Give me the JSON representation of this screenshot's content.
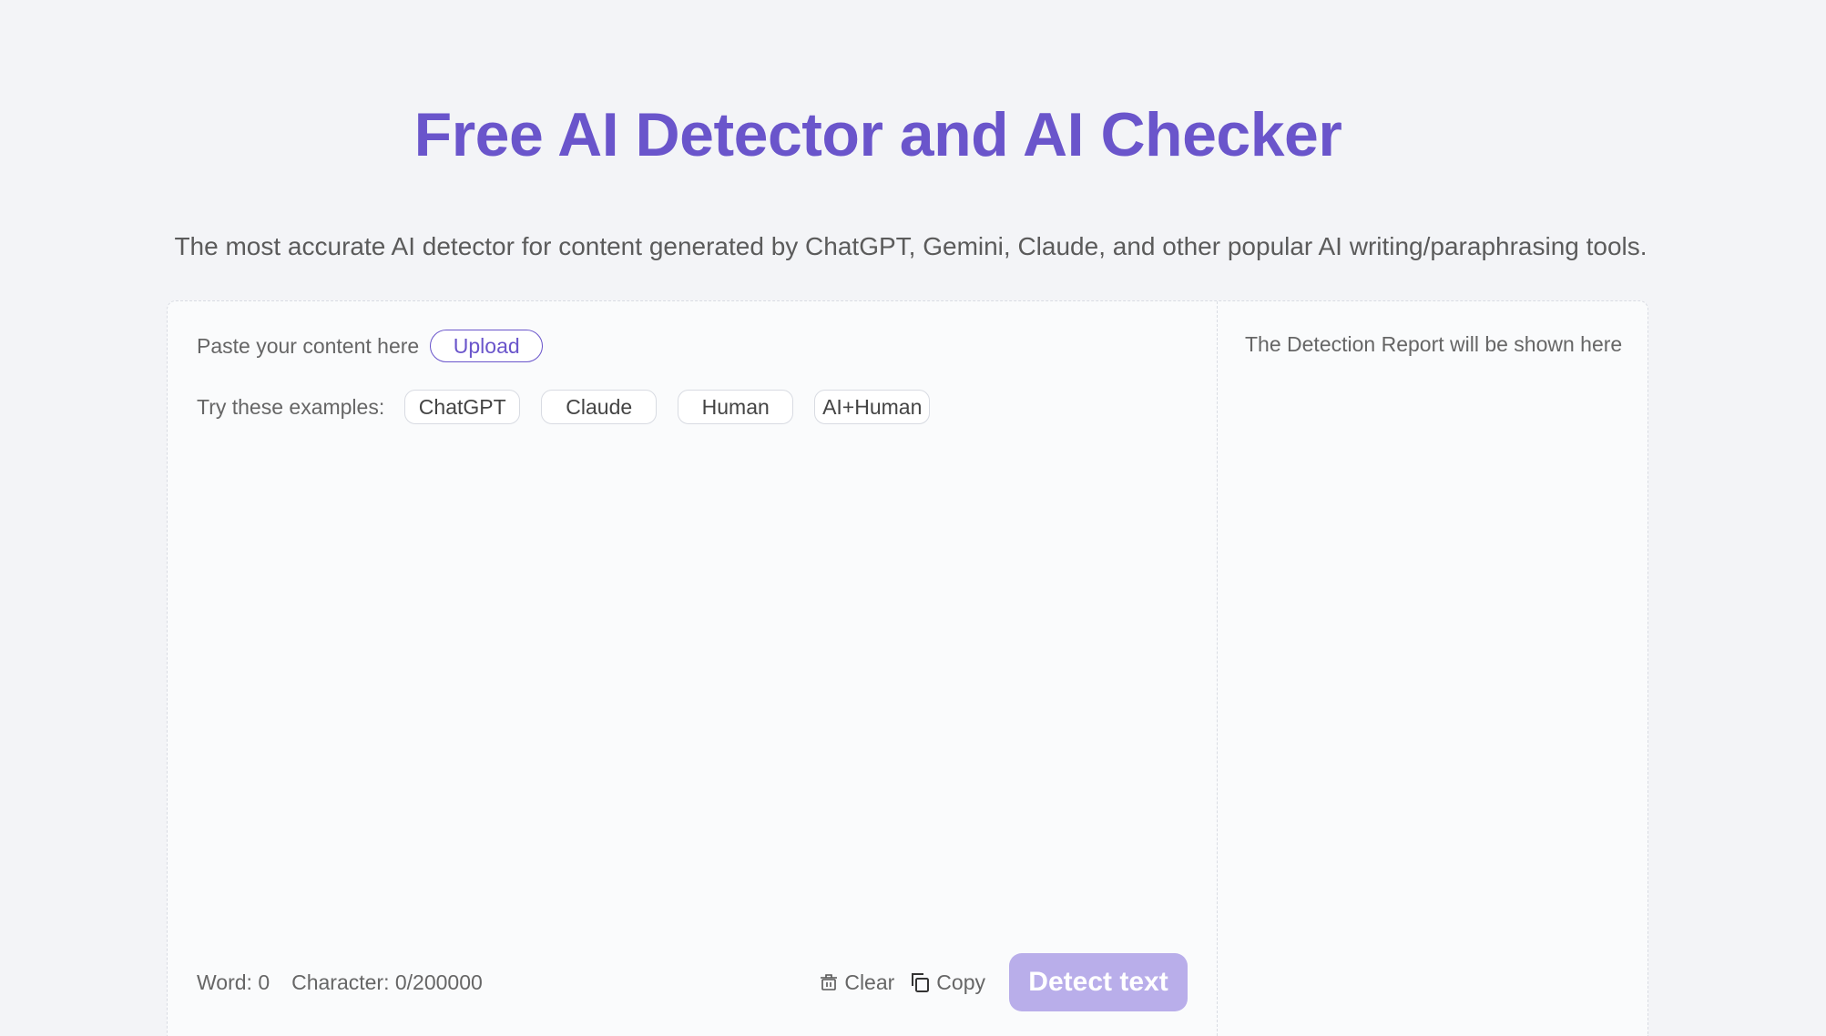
{
  "header": {
    "title": "Free AI Detector and AI Checker",
    "subtitle": "The most accurate AI detector for content generated by ChatGPT, Gemini, Claude, and other popular AI writing/paraphrasing tools."
  },
  "input": {
    "paste_label": "Paste your content here",
    "upload_label": "Upload",
    "examples_label": "Try these examples:",
    "examples": [
      "ChatGPT",
      "Claude",
      "Human",
      "AI+Human"
    ],
    "text_value": ""
  },
  "footer": {
    "word_count": "Word: 0",
    "char_count": "Character: 0/200000",
    "clear_label": "Clear",
    "copy_label": "Copy",
    "detect_label": "Detect text"
  },
  "report": {
    "placeholder": "The Detection Report will be shown here"
  },
  "colors": {
    "accent": "#6a55cb",
    "detect_disabled": "#b9aeea",
    "background": "#f3f4f7"
  },
  "icons": {
    "clear": "trash-icon",
    "copy": "copy-icon"
  }
}
